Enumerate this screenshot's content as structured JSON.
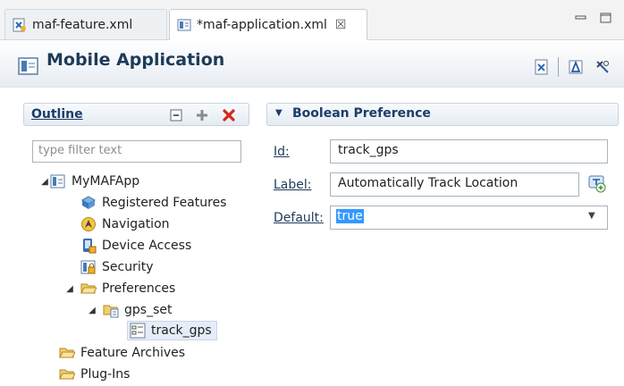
{
  "tabs": [
    {
      "label": "maf-feature.xml",
      "icon": "xml-feature-icon"
    },
    {
      "label": "*maf-application.xml",
      "icon": "app-file-icon",
      "close": "☒"
    }
  ],
  "header": {
    "title": "Mobile Application"
  },
  "outline": {
    "title": "Outline",
    "filter_placeholder": "type filter text",
    "tree": {
      "root": "MyMAFApp",
      "registered_features": "Registered Features",
      "navigation": "Navigation",
      "device_access": "Device Access",
      "security": "Security",
      "preferences": "Preferences",
      "gps_set": "gps_set",
      "track_gps": "track_gps",
      "feature_archives": "Feature Archives",
      "plug_ins": "Plug-Ins"
    }
  },
  "section": {
    "title": "Boolean Preference",
    "id_label": "Id:",
    "id_value": "track_gps",
    "label_label": "Label:",
    "label_value": "Automatically Track Location",
    "default_label": "Default:",
    "default_value": "true"
  },
  "colors": {
    "accent": "#1c3d68",
    "selection": "#3399ff",
    "delete": "#d3281e"
  }
}
